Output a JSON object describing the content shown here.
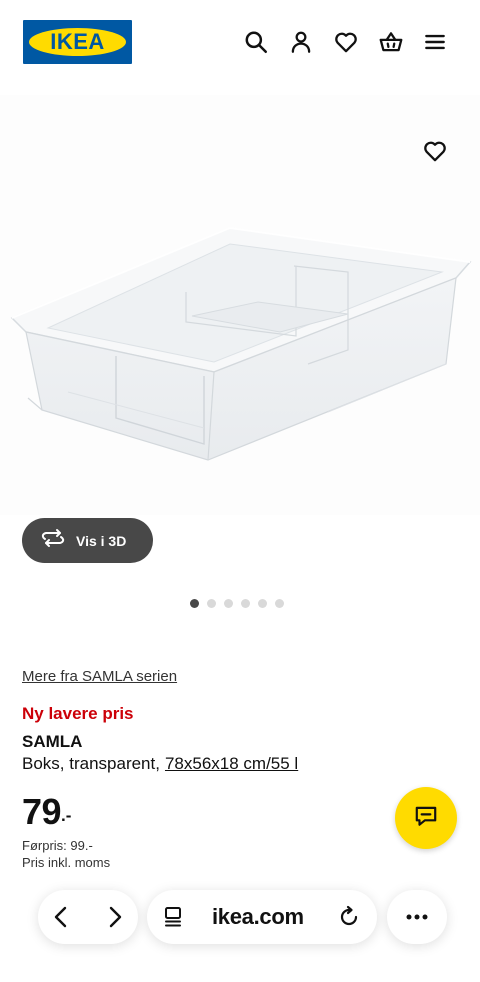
{
  "header": {
    "logo_text": "IKEA",
    "icons": [
      "search-icon",
      "user-icon",
      "heart-icon",
      "basket-icon",
      "menu-icon"
    ]
  },
  "gallery": {
    "favorite_icon": "heart-icon",
    "view_3d_label": "Vis i 3D",
    "dots_total": 6,
    "active_dot": 1
  },
  "product": {
    "series_link": "Mere fra SAMLA serien",
    "promo_label": "Ny lavere pris",
    "name": "SAMLA",
    "description": "Boks, transparent,",
    "dimensions": "78x56x18 cm/55 l",
    "price": "79",
    "price_suffix": ".-",
    "previous_price": "Førpris: 99.-",
    "vat_note": "Pris inkl. moms"
  },
  "browser": {
    "url": "ikea.com"
  },
  "colors": {
    "brand_blue": "#0058a3",
    "brand_yellow": "#ffdb00",
    "promo_red": "#cc0008",
    "dark_button": "#484848"
  }
}
